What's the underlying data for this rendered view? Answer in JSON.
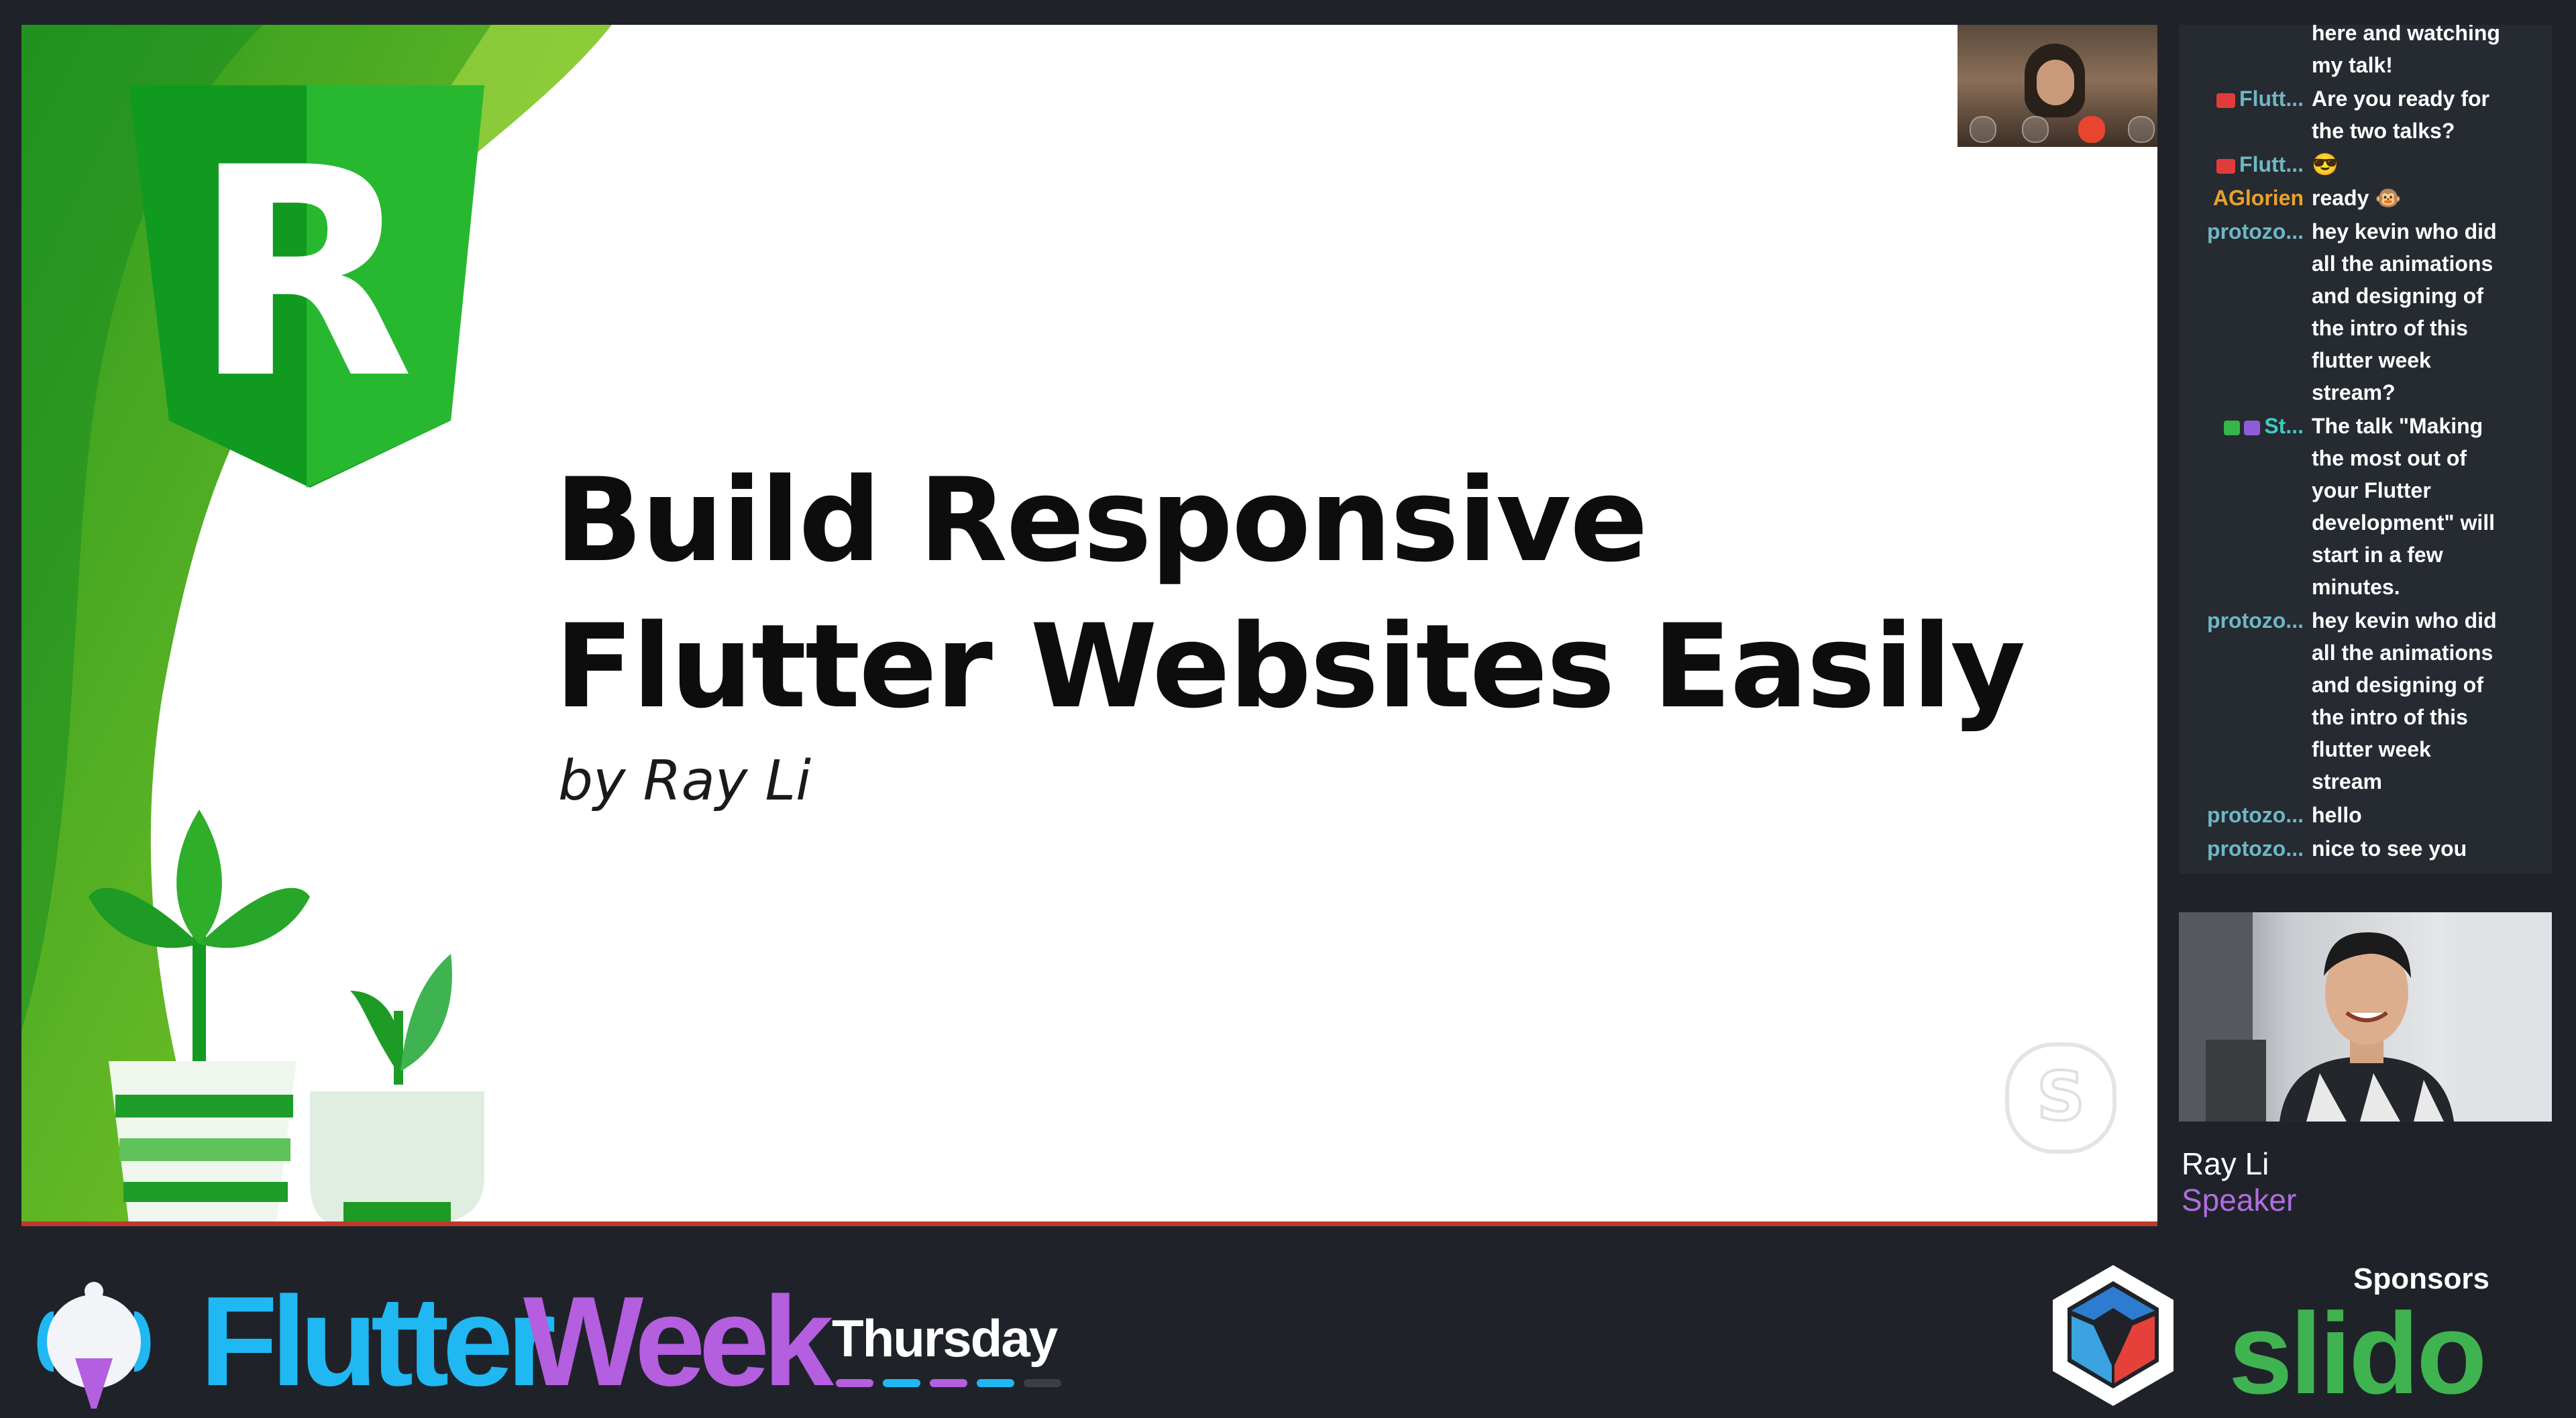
{
  "slide": {
    "title_line1": "Build Responsive",
    "title_line2": "Flutter Websites Easily",
    "byline": "by Ray Li",
    "logo_letter": "R"
  },
  "chat": {
    "messages": [
      {
        "name": "",
        "name_color": "#ffffff",
        "badge": "",
        "lines": [
          "here and watching",
          "my talk!"
        ]
      },
      {
        "name": "Flutt...",
        "name_color": "#6fb7c4",
        "badge": "youtube",
        "lines": [
          "Are you ready for",
          "the two talks?"
        ]
      },
      {
        "name": "Flutt...",
        "name_color": "#6fb7c4",
        "badge": "youtube",
        "lines": [
          "😎"
        ]
      },
      {
        "name": "AGlorien",
        "name_color": "#e9a12b",
        "badge": "",
        "lines": [
          "ready 🐵"
        ]
      },
      {
        "name": "protozo...",
        "name_color": "#6fb7c4",
        "badge": "",
        "lines": [
          "hey kevin who did",
          "all the animations",
          "and designing of",
          "the intro of this",
          "flutter week",
          "stream?"
        ]
      },
      {
        "name": "St...",
        "name_color": "#3ecbc2",
        "badge": "mod",
        "lines": [
          "The talk \"Making",
          "the most out of",
          "your Flutter",
          "development\" will",
          "start in a few",
          "minutes."
        ]
      },
      {
        "name": "protozo...",
        "name_color": "#6fb7c4",
        "badge": "",
        "lines": [
          "hey kevin who did",
          "all the animations",
          "and designing of",
          "the intro of this",
          "flutter week",
          "stream"
        ]
      },
      {
        "name": "protozo...",
        "name_color": "#6fb7c4",
        "badge": "",
        "lines": [
          "hello"
        ]
      },
      {
        "name": "protozo...",
        "name_color": "#6fb7c4",
        "badge": "",
        "lines": [
          "nice to see you"
        ]
      }
    ]
  },
  "speaker": {
    "name": "Ray Li",
    "role": "Speaker"
  },
  "branding": {
    "word1": "Flutter",
    "word2": "Week",
    "day": "Thursday",
    "sponsors_label": "Sponsors",
    "sponsor_name": "slido",
    "colors": {
      "flutter": "#20b8f2",
      "week": "#b45ee0",
      "slido": "#3fb34f"
    }
  },
  "icons": [
    "skype-watermark-icon",
    "mic-icon",
    "camera-icon",
    "hang-up-icon",
    "popout-icon",
    "youtube-badge-icon",
    "moderator-badge-icon",
    "verified-badge-icon",
    "mascot-logo-icon",
    "sponsor-hexagon-logo"
  ]
}
